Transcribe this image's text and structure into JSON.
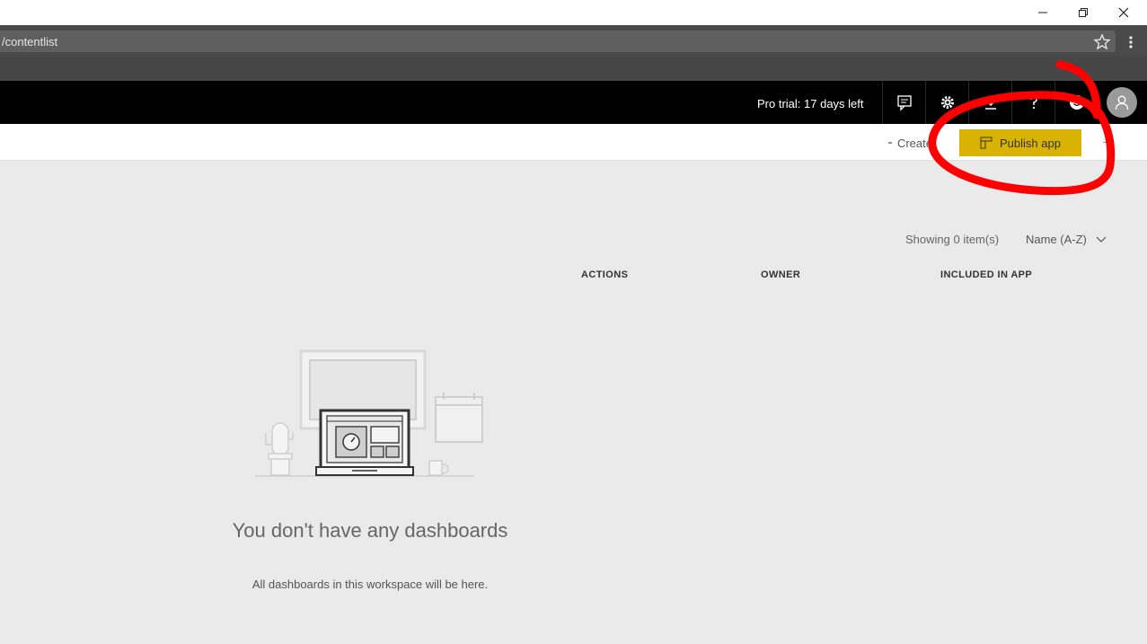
{
  "browser": {
    "url": "/contentlist",
    "icons": {
      "star": "star-icon",
      "menu": "kebab-menu-icon"
    }
  },
  "window_controls": [
    "minimize-icon",
    "restore-icon",
    "close-icon"
  ],
  "header": {
    "trial_text": "Pro trial: 17 days left",
    "icons": [
      "chat-icon",
      "gear-icon",
      "download-icon",
      "help-icon",
      "smiley-icon",
      "avatar-icon"
    ]
  },
  "commandbar": {
    "create_label": "Create",
    "publish_label": "Publish app"
  },
  "list": {
    "showing": "Showing 0 item(s)",
    "sort_label": "Name (A-Z)",
    "columns": [
      "ACTIONS",
      "OWNER",
      "INCLUDED IN APP"
    ]
  },
  "empty_state": {
    "title": "You don't have any dashboards",
    "subtitle": "All dashboards in this workspace will be here."
  },
  "colors": {
    "header_bg": "#000000",
    "accent_yellow": "#d9b302",
    "annotation_red": "#ff0000",
    "content_bg": "#eaeaea"
  }
}
